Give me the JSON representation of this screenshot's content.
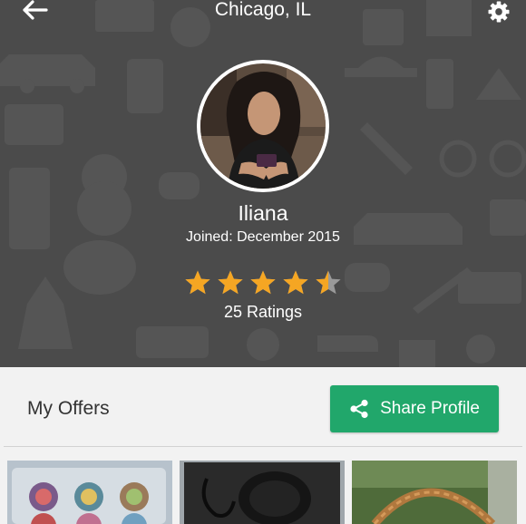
{
  "header": {
    "title": "Chicago, IL",
    "back_icon": "arrow-left-icon",
    "settings_icon": "gear-icon",
    "background_color": "#4b4b4b"
  },
  "profile": {
    "name": "Iliana",
    "joined": "Joined: December 2015",
    "rating": 4.5,
    "rating_max": 5,
    "star_color": "#f5a623",
    "ratings_count_label": "25 Ratings"
  },
  "offers": {
    "title": "My Offers",
    "share_button": {
      "label": "Share Profile",
      "icon": "share-icon",
      "color": "#21a76b"
    }
  }
}
